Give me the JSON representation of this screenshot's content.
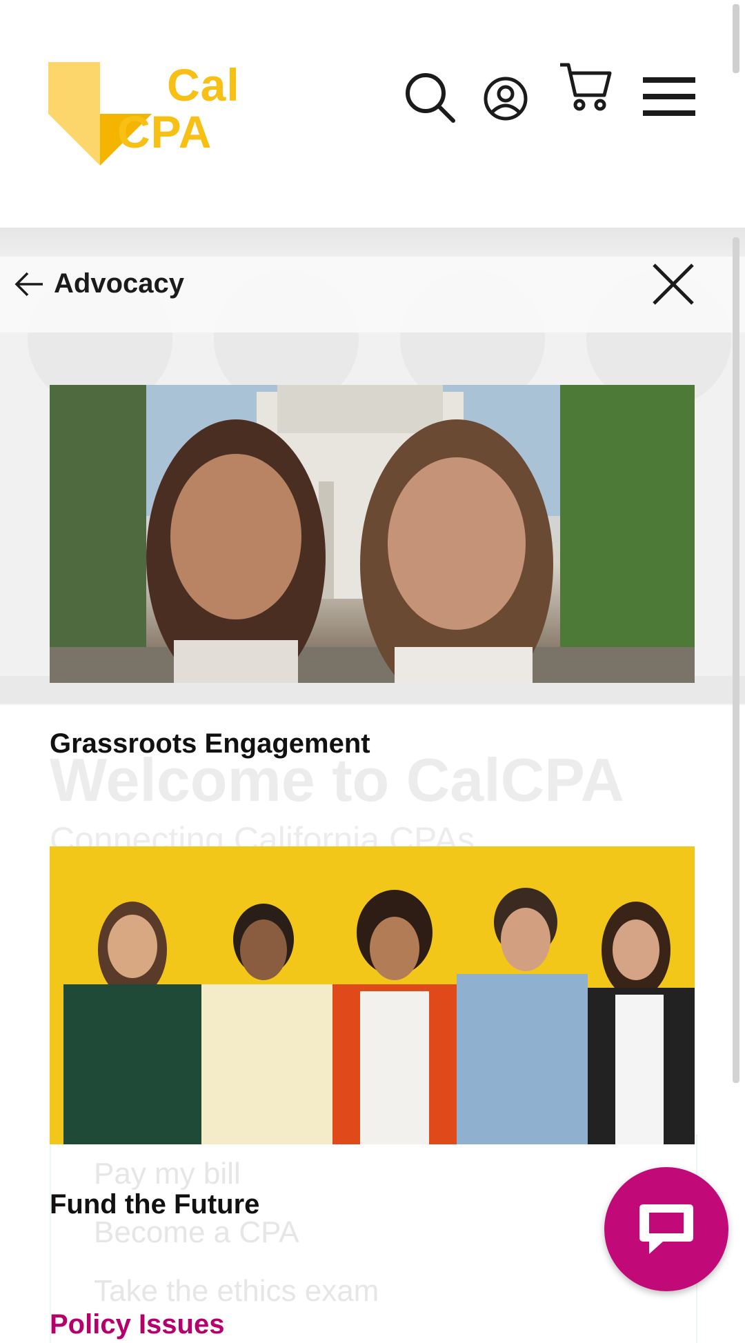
{
  "header": {
    "logo_line1": "Cal",
    "logo_line2": "CPA",
    "brand_color": "#f8bf14",
    "icons": [
      "search-icon",
      "user-account-icon",
      "cart-icon",
      "menu-icon"
    ]
  },
  "background": {
    "welcome_title": "Welcome to CalCPA",
    "subtitle": "Connecting California CPAs",
    "links": [
      "Pay my bill",
      "Become a CPA",
      "Take the ethics exam"
    ]
  },
  "menu": {
    "title": "Advocacy",
    "back_icon": "arrow-left-icon",
    "close_icon": "close-icon",
    "items": [
      {
        "label": "Grassroots Engagement",
        "image": "two-women-capitol-photo"
      },
      {
        "label": "Fund the Future",
        "image": "five-young-people-yellow-wall-photo"
      },
      {
        "label": "Policy Issues"
      }
    ],
    "accent_color": "#b5006c"
  },
  "chat": {
    "icon": "chat-bubble-icon",
    "color": "#c10a78"
  }
}
